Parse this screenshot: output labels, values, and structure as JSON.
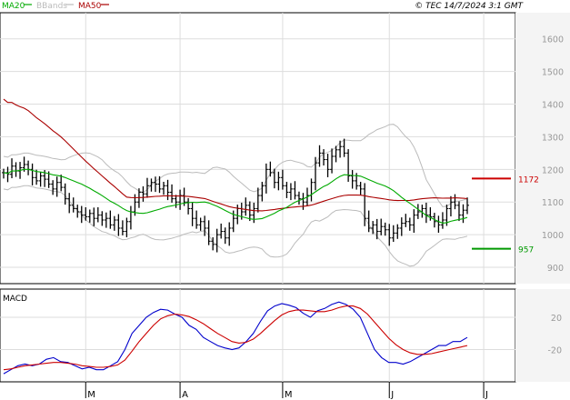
{
  "header": {
    "legend": [
      {
        "label": "MA20",
        "color": "#00aa00"
      },
      {
        "label": "BBands",
        "color": "#bbbbbb"
      },
      {
        "label": "MA50",
        "color": "#aa0000"
      }
    ],
    "timestamp": "© TEC 14/7/2024 3:1 GMT"
  },
  "chart_data": [
    {
      "type": "candlestick",
      "panel": "price",
      "y_ticks": [
        "1600",
        "1500",
        "1400",
        "1300",
        "1200",
        "1100",
        "1000",
        "900"
      ],
      "ylim": [
        850,
        1680
      ],
      "x_ticks": [
        {
          "label": "M",
          "index": 20
        },
        {
          "label": "A",
          "index": 43
        },
        {
          "label": "M",
          "index": 68
        },
        {
          "label": "J",
          "index": 94
        },
        {
          "label": "J",
          "index": 117
        }
      ],
      "levels": [
        {
          "value": 1172,
          "label": "1172",
          "color": "#cc0000"
        },
        {
          "value": 957,
          "label": "957",
          "color": "#009900"
        }
      ],
      "series_colors": {
        "ma20": "#00aa00",
        "ma50": "#aa0000",
        "bbands": "#bbbbbb",
        "bars": "#000000"
      },
      "close": [
        1190,
        1185,
        1210,
        1195,
        1205,
        1215,
        1200,
        1175,
        1165,
        1180,
        1170,
        1155,
        1140,
        1160,
        1145,
        1110,
        1090,
        1080,
        1070,
        1060,
        1055,
        1065,
        1050,
        1060,
        1045,
        1050,
        1030,
        1045,
        1020,
        1010,
        1040,
        1070,
        1100,
        1130,
        1125,
        1150,
        1160,
        1155,
        1140,
        1150,
        1130,
        1110,
        1100,
        1120,
        1100,
        1080,
        1050,
        1030,
        1040,
        1020,
        980,
        970,
        1000,
        1010,
        990,
        1020,
        1050,
        1080,
        1070,
        1090,
        1060,
        1080,
        1120,
        1150,
        1200,
        1190,
        1160,
        1175,
        1150,
        1130,
        1140,
        1120,
        1110,
        1100,
        1120,
        1160,
        1220,
        1250,
        1230,
        1200,
        1240,
        1260,
        1270,
        1250,
        1180,
        1165,
        1150,
        1140,
        1050,
        1020,
        1030,
        1010,
        1025,
        1015,
        990,
        1005,
        1020,
        1035,
        1040,
        1030,
        1060,
        1070,
        1080,
        1060,
        1055,
        1040,
        1030,
        1045,
        1080,
        1100,
        1090,
        1060,
        1075,
        1090
      ]
    },
    {
      "type": "line",
      "panel": "macd",
      "title": "MACD",
      "y_ticks": [
        "20",
        "-20"
      ],
      "ylim": [
        -60,
        55
      ],
      "series": [
        {
          "name": "",
          "color": "#0000cc",
          "values": [
            -50,
            -45,
            -40,
            -38,
            -40,
            -38,
            -32,
            -30,
            -35,
            -36,
            -40,
            -44,
            -42,
            -45,
            -45,
            -40,
            -35,
            -20,
            0,
            10,
            20,
            26,
            30,
            29,
            24,
            20,
            10,
            5,
            -5,
            -10,
            -15,
            -18,
            -20,
            -18,
            -10,
            0,
            15,
            28,
            34,
            37,
            35,
            32,
            25,
            20,
            28,
            31,
            36,
            39,
            36,
            30,
            20,
            0,
            -20,
            -30,
            -36,
            -36,
            -38,
            -35,
            -30,
            -25,
            -20,
            -15,
            -15,
            -10,
            -10,
            -5
          ]
        },
        {
          "name": "",
          "color": "#cc0000",
          "values": [
            -45,
            -44,
            -42,
            -40,
            -39,
            -38,
            -37,
            -36,
            -36,
            -37,
            -38,
            -40,
            -41,
            -42,
            -42,
            -41,
            -39,
            -33,
            -22,
            -10,
            0,
            10,
            18,
            22,
            24,
            23,
            21,
            17,
            12,
            6,
            0,
            -5,
            -10,
            -12,
            -11,
            -7,
            0,
            8,
            16,
            23,
            27,
            29,
            29,
            28,
            27,
            27,
            29,
            32,
            34,
            34,
            31,
            24,
            14,
            4,
            -6,
            -14,
            -20,
            -24,
            -26,
            -26,
            -25,
            -23,
            -21,
            -19,
            -17,
            -15
          ]
        }
      ]
    }
  ]
}
